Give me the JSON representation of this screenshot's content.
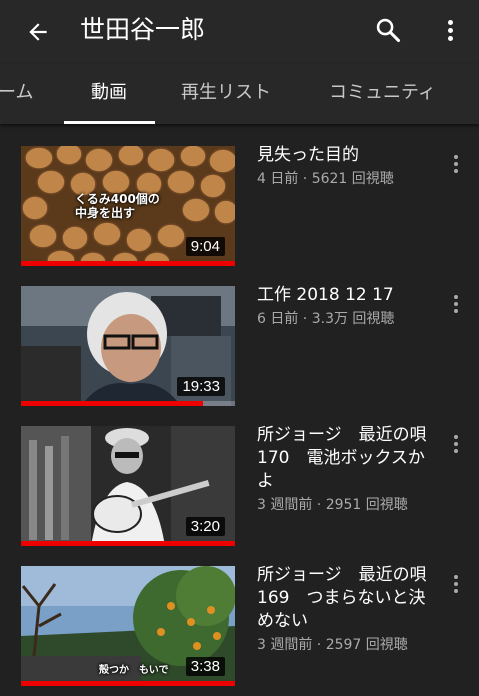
{
  "header": {
    "title": "世田谷一郎",
    "back_icon": "arrow-back-icon",
    "search_icon": "search-icon",
    "more_icon": "more-vert-icon"
  },
  "tabs": [
    {
      "label": "ーム",
      "active": false
    },
    {
      "label": "動画",
      "active": true
    },
    {
      "label": "再生リスト",
      "active": false
    },
    {
      "label": "コミュニティ",
      "active": false
    }
  ],
  "videos": [
    {
      "title": "見失った目的",
      "meta": "4 日前 · 5621 回視聴",
      "duration": "9:04",
      "watched_fraction": 1.0,
      "thumb_caption": "くるみ400個の\n中身を出す"
    },
    {
      "title": "工作 2018 12 17",
      "meta": "6 日前 · 3.3万 回視聴",
      "duration": "19:33",
      "watched_fraction": 0.85,
      "thumb_caption": ""
    },
    {
      "title": "所ジョージ　最近の唄170　電池ボックスかよ",
      "meta": "3 週間前 · 2951 回視聴",
      "duration": "3:20",
      "watched_fraction": 1.0,
      "thumb_caption": ""
    },
    {
      "title": "所ジョージ　最近の唄169　つまらないと決めない",
      "meta": "3 週間前 · 2597 回視聴",
      "duration": "3:38",
      "watched_fraction": 1.0,
      "thumb_caption": "殻つか　もいで"
    }
  ],
  "colors": {
    "background": "#212121",
    "appbar": "#282828",
    "progress": "#ee0000"
  }
}
